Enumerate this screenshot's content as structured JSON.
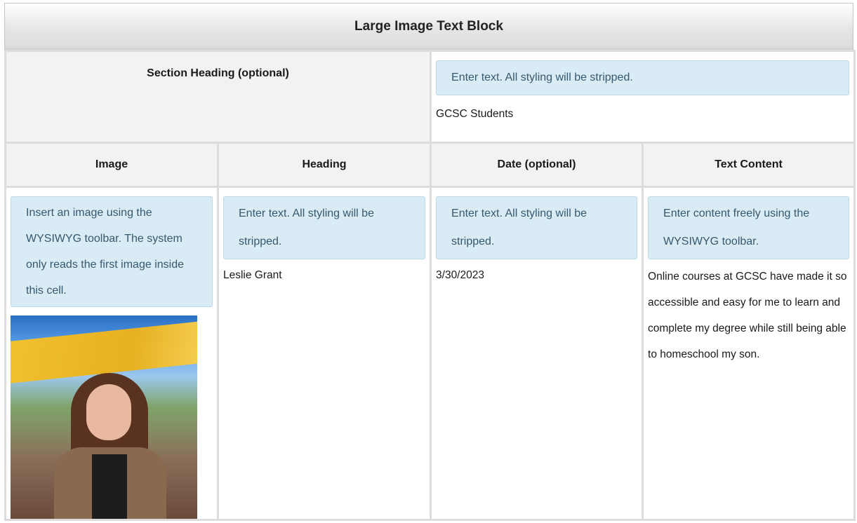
{
  "title": "Large Image Text Block",
  "section": {
    "label": "Section Heading (optional)",
    "hint": "Enter text. All styling will be stripped.",
    "value": "GCSC Students"
  },
  "columns": [
    "Image",
    "Heading",
    "Date (optional)",
    "Text Content"
  ],
  "row": {
    "image_hint": "Insert an image using the WYSIWYG toolbar. The system only reads the first image inside this cell.",
    "heading_hint": "Enter text. All styling will be stripped.",
    "heading_value": "Leslie Grant",
    "date_hint": "Enter text. All styling will be stripped.",
    "date_value": "3/30/2023",
    "content_hint": "Enter content freely using the WYSIWYG toolbar.",
    "content_value": "Online courses at GCSC have made it so accessible and easy for me to learn and complete my degree while still being able to homeschool my son."
  },
  "colors": {
    "hint_bg": "#d9ecf5",
    "hint_text": "#36586e",
    "header_bg": "#f2f2f2",
    "border": "#dcdcdc"
  }
}
